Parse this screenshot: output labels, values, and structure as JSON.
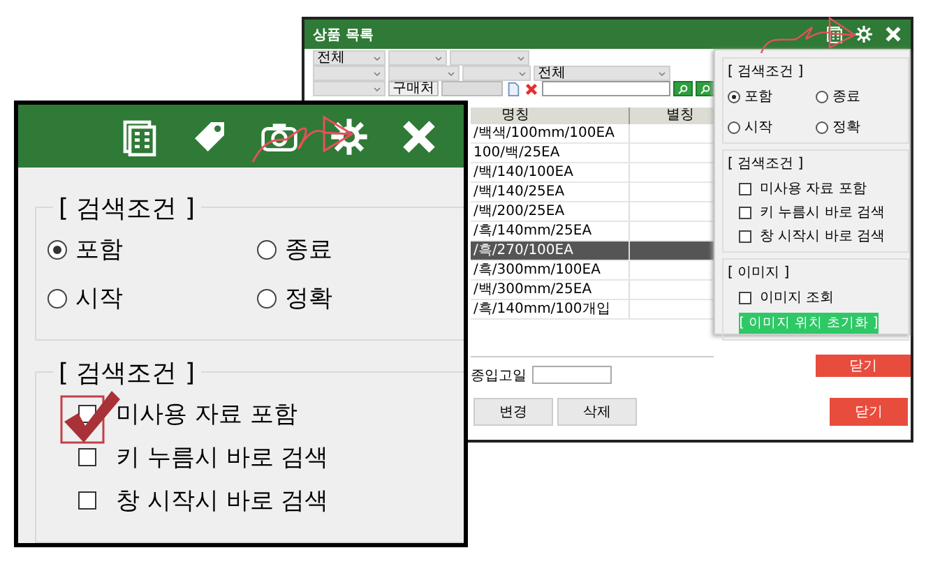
{
  "product_window": {
    "title": "상품 목록",
    "filter_rows": [
      [
        {
          "kind": "combo",
          "value": "전체"
        },
        {
          "kind": "combo"
        },
        {
          "kind": "combo"
        }
      ],
      [
        {
          "kind": "combo"
        },
        {
          "kind": "combo"
        },
        {
          "kind": "combo"
        },
        {
          "kind": "combo",
          "value": "전체"
        }
      ],
      [
        {
          "kind": "combo"
        },
        {
          "kind": "button",
          "label": "구매처"
        },
        {
          "kind": "field"
        },
        {
          "kind": "new"
        },
        {
          "kind": "delete"
        },
        {
          "kind": "search_field"
        },
        {
          "kind": "search"
        },
        {
          "kind": "search"
        }
      ]
    ],
    "table": {
      "columns": [
        "명칭",
        "별칭"
      ],
      "rows": [
        {
          "name": "/백색/100mm/100EA",
          "selected": false
        },
        {
          "name": "100/백/25EA",
          "selected": false
        },
        {
          "name": "/백/140/100EA",
          "selected": false
        },
        {
          "name": "/백/140/25EA",
          "selected": false
        },
        {
          "name": "/백/200/25EA",
          "selected": false
        },
        {
          "name": "/흑/140mm/25EA",
          "selected": false
        },
        {
          "name": "/흑/270/100EA",
          "selected": true
        },
        {
          "name": "/흑/300mm/100EA",
          "selected": false
        },
        {
          "name": "/백/300mm/25EA",
          "selected": false
        },
        {
          "name": "/흑/140mm/100개입",
          "selected": false
        }
      ]
    },
    "date_label": "종입고일",
    "buttons": [
      {
        "label": "변경",
        "kind": "plain"
      },
      {
        "label": "삭제",
        "kind": "plain"
      },
      {
        "label": "닫기",
        "kind": "close"
      }
    ],
    "options_panel": {
      "groups": [
        {
          "title": "[ 검색조건 ]",
          "kind": "radios",
          "items": [
            {
              "label": "포함",
              "selected": true
            },
            {
              "label": "종료",
              "selected": false
            },
            {
              "label": "시작",
              "selected": false
            },
            {
              "label": "정확",
              "selected": false
            }
          ]
        },
        {
          "title": "[ 검색조건 ]",
          "kind": "checks",
          "items": [
            {
              "label": "미사용 자료 포함",
              "checked": false
            },
            {
              "label": "키 누름시 바로 검색",
              "checked": false
            },
            {
              "label": "창 시작시 바로 검색",
              "checked": false
            }
          ]
        },
        {
          "title": "[ 이미지 ]",
          "kind": "checks",
          "items": [
            {
              "label": "이미지 조회",
              "checked": false
            }
          ],
          "button": "[ 이미지 위치 초기화 ]"
        }
      ],
      "close_label": "닫기"
    }
  },
  "zoom_inset": {
    "groups": [
      {
        "title": "[ 검색조건 ]",
        "kind": "radios",
        "items": [
          {
            "label": "포함",
            "selected": true
          },
          {
            "label": "종료",
            "selected": false
          },
          {
            "label": "시작",
            "selected": false
          },
          {
            "label": "정확",
            "selected": false
          }
        ]
      },
      {
        "title": "[ 검색조건 ]",
        "kind": "checks",
        "items": [
          {
            "label": "미사용 자료 포함",
            "checked": false
          },
          {
            "label": "키 누름시 바로 검색",
            "checked": false
          },
          {
            "label": "창 시작시 바로 검색",
            "checked": false
          }
        ]
      }
    ]
  }
}
